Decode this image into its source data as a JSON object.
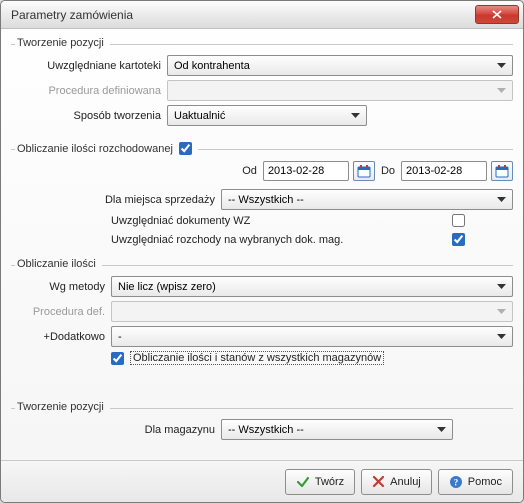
{
  "window": {
    "title": "Parametry zamówienia"
  },
  "group1": {
    "title": "Tworzenie pozycji",
    "field1_label": "Uwzględniane kartoteki",
    "field1_value": "Od kontrahenta",
    "field2_label": "Procedura definiowana",
    "field2_value": "",
    "field3_label": "Sposób tworzenia",
    "field3_value": "Uaktualnić"
  },
  "group2": {
    "title": "Obliczanie ilości rozchodowanej",
    "enabled": true,
    "date_from_label": "Od",
    "date_from": "2013-02-28",
    "date_to_label": "Do",
    "date_to": "2013-02-28",
    "place_label": "Dla miejsca sprzedaży",
    "place_value": "-- Wszystkich --",
    "chk_wz_label": "Uwzględniać dokumenty WZ",
    "chk_wz": false,
    "chk_mag_label": "Uwzględniać rozchody na wybranych dok. mag.",
    "chk_mag": true
  },
  "group3": {
    "title": "Obliczanie ilości",
    "method_label": "Wg metody",
    "method_value": "Nie licz (wpisz zero)",
    "proc_label": "Procedura def.",
    "proc_value": "",
    "extra_label": "+Dodatkowo",
    "extra_value": "-",
    "all_stocks": true,
    "all_stocks_label": "Obliczanie ilości i stanów z wszystkich magazynów"
  },
  "group4": {
    "title": "Tworzenie pozycji",
    "store_label": "Dla magazynu",
    "store_value": "-- Wszystkich --"
  },
  "buttons": {
    "create": "Twórz",
    "cancel": "Anuluj",
    "help": "Pomoc"
  }
}
